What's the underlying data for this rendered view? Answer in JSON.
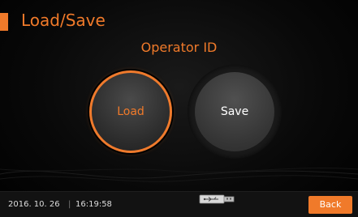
{
  "header": {
    "title": "Load/Save"
  },
  "main": {
    "subtitle": "Operator ID",
    "load_label": "Load",
    "save_label": "Save"
  },
  "status_bar": {
    "date": "2016. 10. 26",
    "separator": "|",
    "time": "16:19:58",
    "usb_icon": "usb-drive-icon",
    "back_label": "Back"
  },
  "colors": {
    "accent": "#f07a2a",
    "background": "#000000",
    "button_dark": "#343434"
  }
}
